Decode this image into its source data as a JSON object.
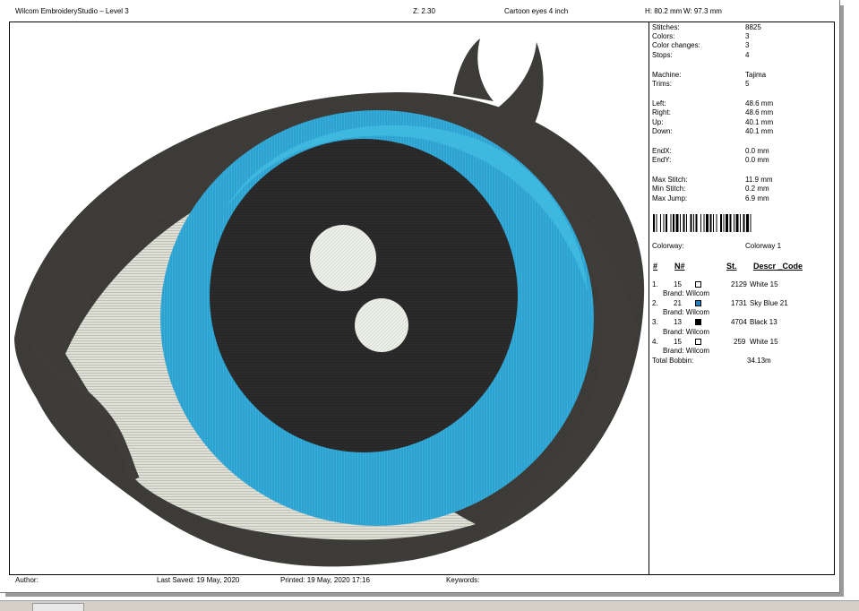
{
  "header": {
    "app_title": "Wilcom EmbroideryStudio – Level 3",
    "zoom": "Z: 2.30",
    "design_name": "Cartoon eyes 4 inch",
    "height": "H: 80.2 mm",
    "width": "W: 97.3 mm"
  },
  "stats": {
    "stitches_label": "Stitches:",
    "stitches_value": "8825",
    "colors_label": "Colors:",
    "colors_value": "3",
    "color_changes_label": "Color changes:",
    "color_changes_value": "3",
    "stops_label": "Stops:",
    "stops_value": "4",
    "machine_label": "Machine:",
    "machine_value": "Tajima",
    "trims_label": "Trims:",
    "trims_value": "5",
    "left_label": "Left:",
    "left_value": "48.6 mm",
    "right_label": "Right:",
    "right_value": "48.6 mm",
    "up_label": "Up:",
    "up_value": "40.1 mm",
    "down_label": "Down:",
    "down_value": "40.1 mm",
    "endx_label": "EndX:",
    "endx_value": "0.0 mm",
    "endy_label": "EndY:",
    "endy_value": "0.0 mm",
    "max_stitch_label": "Max Stitch:",
    "max_stitch_value": "11.9 mm",
    "min_stitch_label": "Min Stitch:",
    "min_stitch_value": "0.2 mm",
    "max_jump_label": "Max Jump:",
    "max_jump_value": "6.9 mm",
    "colorway_label": "Colorway:",
    "colorway_value": "Colorway 1"
  },
  "thread_table": {
    "headers": {
      "index": "#",
      "number": "N#",
      "stitches": "St.",
      "desc": "Descr _Code"
    },
    "rows": [
      {
        "index": "1.",
        "number": "15",
        "swatch": "#ffffff",
        "stitches": "2129",
        "desc": "White 15",
        "brand": "Brand: Wilcom"
      },
      {
        "index": "2.",
        "number": "21",
        "swatch": "#1f7fc4",
        "stitches": "1731",
        "desc": "Sky Blue 21",
        "brand": "Brand: Wilcom"
      },
      {
        "index": "3.",
        "number": "13",
        "swatch": "#000000",
        "stitches": "4704",
        "desc": "Black 13",
        "brand": "Brand: Wilcom"
      },
      {
        "index": "4.",
        "number": "15",
        "swatch": "#ffffff",
        "stitches": "259",
        "desc": "White 15",
        "brand": "Brand: Wilcom"
      }
    ],
    "total_bobbin_label": "Total Bobbin:",
    "total_bobbin_value": "34.13m"
  },
  "footer": {
    "author": "Author:",
    "last_saved": "Last Saved: 19 May, 2020",
    "printed": "Printed: 19 May, 2020 17:16",
    "keywords": "Keywords:"
  },
  "colors": {
    "outline": "#3f3d3a",
    "iris": "#2aa3d2",
    "pupil": "#2b2b2b",
    "sclera": "#dfe0d6",
    "highlight": "#eef0ea"
  }
}
